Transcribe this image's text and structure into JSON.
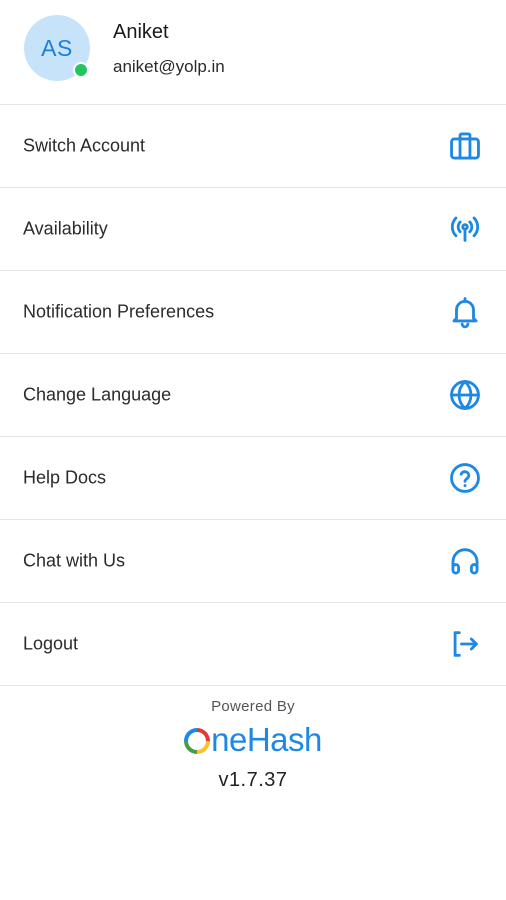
{
  "profile": {
    "initials": "AS",
    "name": "Aniket",
    "email": "aniket@yolp.in",
    "status": "online",
    "status_color": "#22c55e",
    "avatar_bg": "#c7e3f9",
    "avatar_fg": "#1d7fd6"
  },
  "menu": {
    "items": [
      {
        "label": "Switch Account",
        "icon": "briefcase-icon"
      },
      {
        "label": "Availability",
        "icon": "broadcast-icon"
      },
      {
        "label": "Notification Preferences",
        "icon": "bell-icon"
      },
      {
        "label": "Change Language",
        "icon": "globe-icon"
      },
      {
        "label": "Help Docs",
        "icon": "help-circle-icon"
      },
      {
        "label": "Chat with Us",
        "icon": "headphones-icon"
      },
      {
        "label": "Logout",
        "icon": "logout-icon"
      }
    ]
  },
  "footer": {
    "powered_by": "Powered By",
    "brand_first": "O",
    "brand_rest": "neHash",
    "version": "v1.7.37"
  },
  "colors": {
    "accent": "#1e88e5",
    "divider": "#e6e6e6"
  }
}
